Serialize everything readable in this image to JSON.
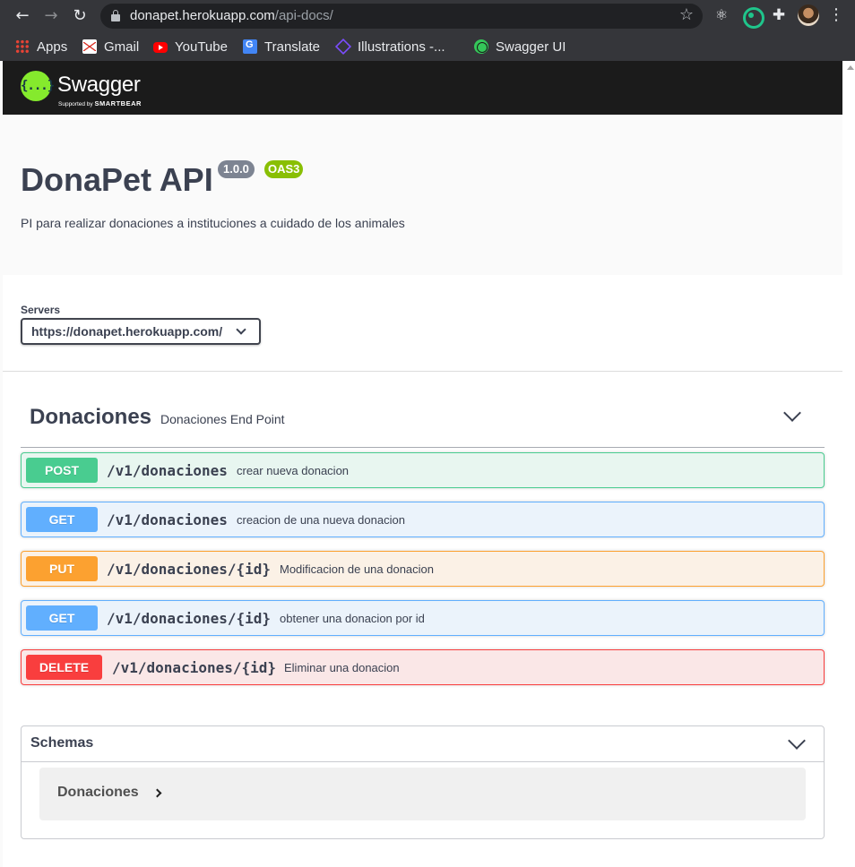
{
  "browser": {
    "url_host": "donapet.herokuapp.com",
    "url_path": "/api-docs/",
    "bookmarks": [
      {
        "label": "Apps",
        "icon": "apps-grid-icon"
      },
      {
        "label": "Gmail",
        "icon": "gmail-icon"
      },
      {
        "label": "YouTube",
        "icon": "youtube-icon"
      },
      {
        "label": "Translate",
        "icon": "translate-icon"
      },
      {
        "label": "Illustrations -...",
        "icon": "illustrations-icon"
      },
      {
        "label": "Swagger UI",
        "icon": "globe-icon"
      }
    ]
  },
  "swagger": {
    "logo_text": "Swagger",
    "logo_glyph": "{...}",
    "supported_by": "Supported by",
    "smartbear": "SMARTBEAR",
    "brand_color": "#85ea2d"
  },
  "info": {
    "title": "DonaPet API",
    "version": "1.0.0",
    "oas": "OAS3",
    "description": "PI para realizar donaciones a instituciones a cuidado de los animales"
  },
  "servers": {
    "label": "Servers",
    "selected": "https://donapet.herokuapp.com/"
  },
  "tag": {
    "name": "Donaciones",
    "description": "Donaciones End Point"
  },
  "operations": [
    {
      "method": "POST",
      "path": "/v1/donaciones",
      "summary": "crear nueva donacion",
      "color": "#49cc90"
    },
    {
      "method": "GET",
      "path": "/v1/donaciones",
      "summary": "creacion de una nueva donacion",
      "color": "#61affe"
    },
    {
      "method": "PUT",
      "path": "/v1/donaciones/{id}",
      "summary": "Modificacion de una donacion",
      "color": "#fca130"
    },
    {
      "method": "GET",
      "path": "/v1/donaciones/{id}",
      "summary": "obtener una donacion por id",
      "color": "#61affe"
    },
    {
      "method": "DELETE",
      "path": "/v1/donaciones/{id}",
      "summary": "Eliminar una donacion",
      "color": "#f93e3e"
    }
  ],
  "schemas": {
    "title": "Schemas",
    "models": [
      "Donaciones"
    ]
  }
}
